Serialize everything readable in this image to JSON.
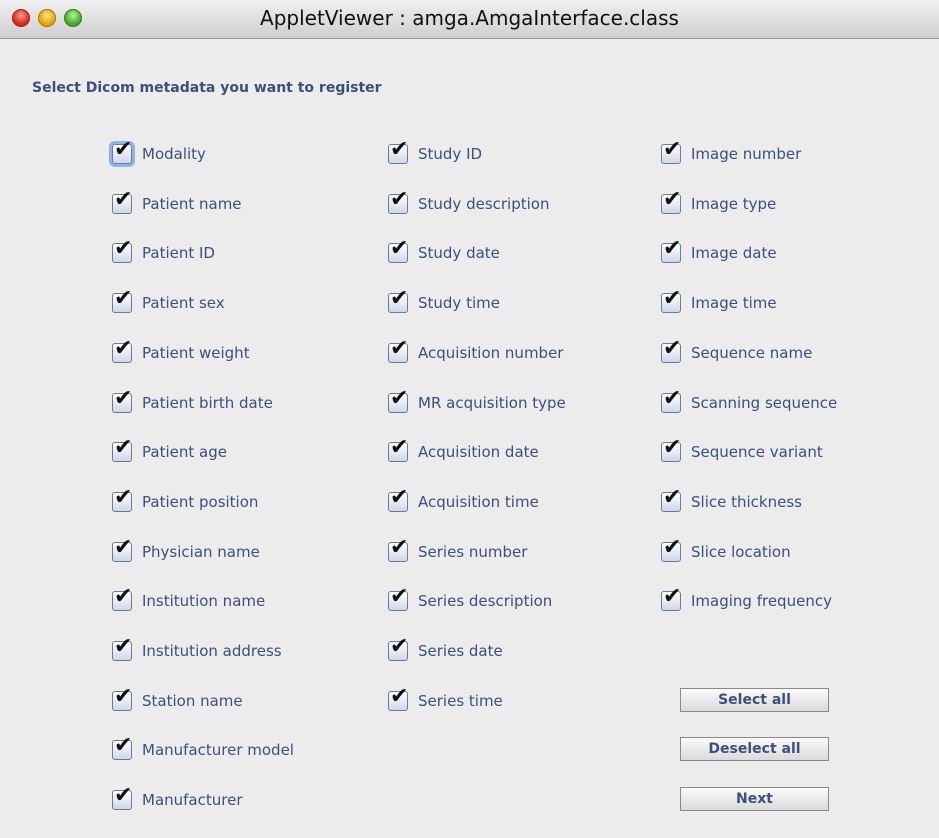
{
  "window": {
    "title": "AppletViewer : amga.AmgaInterface.class"
  },
  "prompt": "Select Dicom metadata you want to register",
  "columns": [
    {
      "items": [
        {
          "label": "Modality",
          "checked": true
        },
        {
          "label": "Patient name",
          "checked": true
        },
        {
          "label": "Patient ID",
          "checked": true
        },
        {
          "label": "Patient sex",
          "checked": true
        },
        {
          "label": "Patient weight",
          "checked": true
        },
        {
          "label": "Patient birth date",
          "checked": true
        },
        {
          "label": "Patient age",
          "checked": true
        },
        {
          "label": "Patient position",
          "checked": true
        },
        {
          "label": "Physician name",
          "checked": true
        },
        {
          "label": "Institution name",
          "checked": true
        },
        {
          "label": "Institution address",
          "checked": true
        },
        {
          "label": "Station name",
          "checked": true
        },
        {
          "label": "Manufacturer model",
          "checked": true
        },
        {
          "label": "Manufacturer",
          "checked": true
        }
      ]
    },
    {
      "items": [
        {
          "label": "Study ID",
          "checked": true
        },
        {
          "label": "Study description",
          "checked": true
        },
        {
          "label": "Study date",
          "checked": true
        },
        {
          "label": "Study time",
          "checked": true
        },
        {
          "label": "Acquisition number",
          "checked": true
        },
        {
          "label": "MR acquisition type",
          "checked": true
        },
        {
          "label": "Acquisition date",
          "checked": true
        },
        {
          "label": "Acquisition time",
          "checked": true
        },
        {
          "label": "Series number",
          "checked": true
        },
        {
          "label": "Series description",
          "checked": true
        },
        {
          "label": "Series date",
          "checked": true
        },
        {
          "label": "Series time",
          "checked": true
        }
      ]
    },
    {
      "items": [
        {
          "label": "Image number",
          "checked": true
        },
        {
          "label": "Image type",
          "checked": true
        },
        {
          "label": "Image date",
          "checked": true
        },
        {
          "label": "Image time",
          "checked": true
        },
        {
          "label": "Sequence name",
          "checked": true
        },
        {
          "label": "Scanning sequence",
          "checked": true
        },
        {
          "label": "Sequence variant",
          "checked": true
        },
        {
          "label": "Slice thickness",
          "checked": true
        },
        {
          "label": "Slice location",
          "checked": true
        },
        {
          "label": "Imaging frequency",
          "checked": true
        }
      ]
    }
  ],
  "buttons": {
    "select_all": "Select all",
    "deselect_all": "Deselect all",
    "next": "Next"
  },
  "colors": {
    "label_text": "#3d4f7a",
    "focus_ring": "#8fb3e6"
  }
}
